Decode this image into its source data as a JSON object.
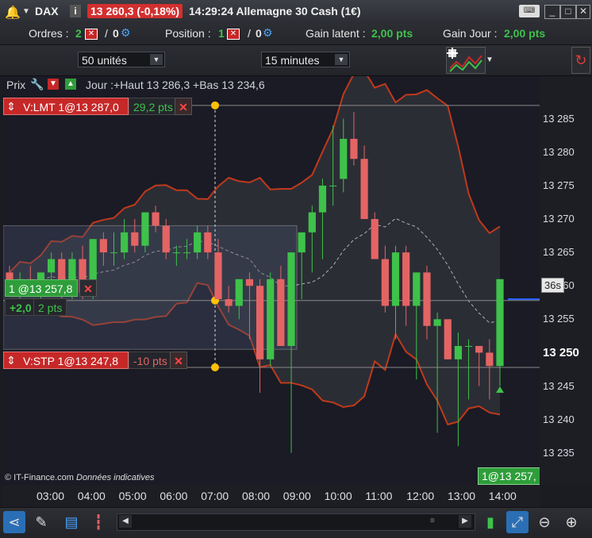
{
  "titlebar": {
    "symbol": "DAX",
    "price": "13 260,3 (-0,18%)",
    "time_name": "14:29:24 Allemagne 30 Cash (1€)"
  },
  "infobar": {
    "orders_label": "Ordres :",
    "orders_a": "2",
    "orders_sep": "/",
    "orders_b": "0",
    "position_label": "Position :",
    "position_a": "1",
    "position_sep": "/",
    "position_b": "0",
    "gain_latent_label": "Gain latent :",
    "gain_latent_value": "2,00 pts",
    "gain_jour_label": "Gain Jour :",
    "gain_jour_value": "2,00 pts"
  },
  "toolbar": {
    "units_value": "50 unités",
    "timeframe_value": "15 minutes"
  },
  "chart": {
    "prix_label": "Prix",
    "day_info": "Jour :+Haut 13 286,3 +Bas 13 234,6",
    "watermark_source": "© IT-Finance.com",
    "watermark_note": "Données indicatives",
    "countdown": "36s",
    "bottom_tag": "1@13 257,",
    "last_price_tick": "13 250"
  },
  "orders": {
    "limit_label": "V:LMT 1@13 287,0",
    "limit_pts": "29,2 pts",
    "position_label": "1 @13 257,8",
    "position_gain": "+2,0",
    "position_pts": "2 pts",
    "stop_label": "V:STP 1@13 247,8",
    "stop_pts": "-10 pts"
  },
  "colors": {
    "up": "#3ec24a",
    "down": "#e46464",
    "bollinger": "#c0391b",
    "ma": "#b0b0b0",
    "teal": "#1aa3a3"
  },
  "chart_data": {
    "type": "candlestick",
    "ylim": [
      13232,
      13289
    ],
    "yticks": [
      "13 285",
      "13 280",
      "13 275",
      "13 270",
      "13 265",
      "13 260",
      "13 255",
      "13 250",
      "13 245",
      "13 240",
      "13 235"
    ],
    "xticks": [
      "03:00",
      "04:00",
      "05:00",
      "06:00",
      "07:00",
      "08:00",
      "09:00",
      "10:00",
      "11:00",
      "12:00",
      "13:00",
      "14:00"
    ],
    "candles": [
      [
        13262,
        13263,
        13259,
        13260
      ],
      [
        13260,
        13262,
        13258,
        13261
      ],
      [
        13261,
        13263,
        13259,
        13260
      ],
      [
        13260,
        13262,
        13258,
        13262
      ],
      [
        13262,
        13265,
        13261,
        13264
      ],
      [
        13264,
        13265,
        13258,
        13259
      ],
      [
        13259,
        13265,
        13258,
        13264
      ],
      [
        13264,
        13266,
        13258,
        13259
      ],
      [
        13259,
        13267,
        13258,
        13267
      ],
      [
        13267,
        13268,
        13263,
        13265
      ],
      [
        13265,
        13268,
        13263,
        13265
      ],
      [
        13265,
        13270,
        13264,
        13268
      ],
      [
        13268,
        13270,
        13265,
        13266
      ],
      [
        13266,
        13271,
        13265,
        13271
      ],
      [
        13271,
        13272,
        13268,
        13269
      ],
      [
        13269,
        13270,
        13264,
        13265
      ],
      [
        13265,
        13266,
        13263,
        13265
      ],
      [
        13265,
        13267,
        13264,
        13265
      ],
      [
        13265,
        13269,
        13264,
        13268
      ],
      [
        13268,
        13269,
        13264,
        13265
      ],
      [
        13265,
        13267,
        13258,
        13258
      ],
      [
        13258,
        13260,
        13256,
        13257
      ],
      [
        13257,
        13260,
        13255,
        13261
      ],
      [
        13261,
        13262,
        13252,
        13260
      ],
      [
        13260,
        13261,
        13244,
        13249
      ],
      [
        13249,
        13262,
        13248,
        13261
      ],
      [
        13261,
        13263,
        13252,
        13251
      ],
      [
        13251,
        13265,
        13235,
        13265
      ],
      [
        13265,
        13268,
        13258,
        13268
      ],
      [
        13268,
        13272,
        13262,
        13271
      ],
      [
        13271,
        13276,
        13264,
        13275
      ],
      [
        13275,
        13284,
        13272,
        13275
      ],
      [
        13276,
        13285,
        13274,
        13282
      ],
      [
        13282,
        13286,
        13278,
        13279
      ],
      [
        13279,
        13281,
        13270,
        13270
      ],
      [
        13270,
        13271,
        13264,
        13264
      ],
      [
        13264,
        13266,
        13256,
        13257
      ],
      [
        13257,
        13266,
        13252,
        13265
      ],
      [
        13265,
        13266,
        13254,
        13257
      ],
      [
        13257,
        13262,
        13246,
        13262
      ],
      [
        13262,
        13263,
        13252,
        13254
      ],
      [
        13254,
        13256,
        13238,
        13255
      ],
      [
        13255,
        13255,
        13249,
        13249
      ],
      [
        13249,
        13253,
        13236,
        13251
      ],
      [
        13251,
        13252,
        13243,
        13251
      ],
      [
        13251,
        13251,
        13245,
        13250
      ],
      [
        13250,
        13252,
        13243,
        13248
      ],
      [
        13248,
        13261,
        13245,
        13261
      ]
    ],
    "limit_price": 13287.0,
    "position_price": 13257.8,
    "stop_price": 13247.8
  }
}
